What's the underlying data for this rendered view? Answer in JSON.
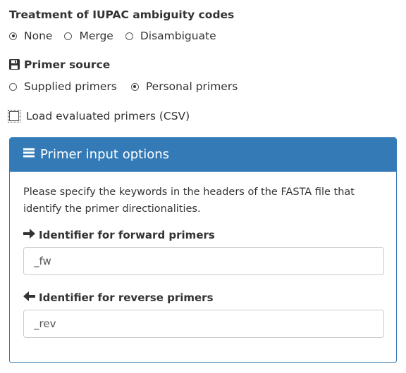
{
  "iupac": {
    "heading": "Treatment of IUPAC ambiguity codes",
    "options": [
      "None",
      "Merge",
      "Disambiguate"
    ],
    "selected": "None"
  },
  "primer_source": {
    "heading_icon": "floppy-disk-icon",
    "heading": "Primer source",
    "options": [
      "Supplied primers",
      "Personal primers"
    ],
    "selected": "Personal primers"
  },
  "load_evaluated": {
    "label": "Load evaluated primers (CSV)",
    "checked": false
  },
  "panel": {
    "heading_icon": "hamburger-menu-icon",
    "title": "Primer input options",
    "accent_color": "#337ab7",
    "description": "Please specify the keywords in the headers of the FASTA file that identify the primer directionalities.",
    "forward": {
      "icon": "arrow-right-icon",
      "label": "Identifier for forward primers",
      "value": "_fw"
    },
    "reverse": {
      "icon": "arrow-left-icon",
      "label": "Identifier for reverse primers",
      "value": "_rev"
    }
  }
}
